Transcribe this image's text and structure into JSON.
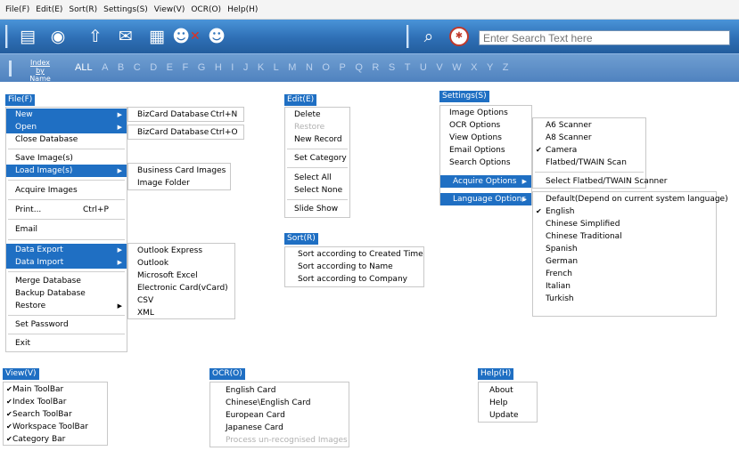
{
  "menubar": [
    "File(F)",
    "Edit(E)",
    "Sort(R)",
    "Settings(S)",
    "View(V)",
    "OCR(O)",
    "Help(H)"
  ],
  "toolbar": {
    "icons": [
      "scan-card-icon",
      "camera-icon",
      "import-icon",
      "export-icon",
      "card-view-icon",
      "delete-contact-icon",
      "group-icon",
      "search-icon",
      "ocr-icon"
    ],
    "search_placeholder": "Enter Search Text here"
  },
  "indexbar": {
    "label_line1": "Index by",
    "label_line2": "Name",
    "letters": [
      "ALL",
      "A",
      "B",
      "C",
      "D",
      "E",
      "F",
      "G",
      "H",
      "I",
      "J",
      "K",
      "L",
      "M",
      "N",
      "O",
      "P",
      "Q",
      "R",
      "S",
      "T",
      "U",
      "V",
      "W",
      "X",
      "Y",
      "Z"
    ]
  },
  "file_menu": {
    "title": "File(F)",
    "items": {
      "new": "New",
      "open": "Open",
      "close": "Close Database",
      "save": "Save Image(s)",
      "load": "Load Image(s)",
      "acquire": "Acquire Images",
      "print": "Print...",
      "print_sc": "Ctrl+P",
      "email": "Email",
      "export": "Data Export",
      "import": "Data Import",
      "merge": "Merge Database",
      "backup": "Backup Database",
      "restore": "Restore",
      "password": "Set Password",
      "exit": "Exit"
    },
    "new_sub": {
      "label": "BizCard Database",
      "shortcut": "Ctrl+N"
    },
    "open_sub": {
      "label": "BizCard Database",
      "shortcut": "Ctrl+O"
    },
    "load_sub": [
      "Business Card Images",
      "Image Folder"
    ],
    "export_sub": [
      "Outlook Express",
      "Outlook",
      "Microsoft Excel",
      "Electronic Card(vCard)",
      "CSV",
      "XML"
    ]
  },
  "edit_menu": {
    "title": "Edit(E)",
    "items": [
      "Delete",
      "Restore",
      "New Record",
      "Set Category",
      "Select All",
      "Select None",
      "Slide Show"
    ]
  },
  "sort_menu": {
    "title": "Sort(R)",
    "items": [
      "Sort according to Created Time",
      "Sort according to Name",
      "Sort according to Company"
    ]
  },
  "settings_menu": {
    "title": "Settings(S)",
    "items": [
      "Image Options",
      "OCR Options",
      "View Options",
      "Email Options",
      "Search Options",
      "Acquire Options",
      "Language Options"
    ],
    "acquire_sub": [
      "A6 Scanner",
      "A8 Scanner",
      "Camera",
      "Flatbed/TWAIN Scan",
      "Select Flatbed/TWAIN Scanner"
    ],
    "language_sub": [
      "Default(Depend on current system language)",
      "English",
      "Chinese Simplified",
      "Chinese Traditional",
      "Spanish",
      "German",
      "French",
      "Italian",
      "Turkish"
    ]
  },
  "view_menu": {
    "title": "View(V)",
    "items": [
      "Main ToolBar",
      "Index ToolBar",
      "Search ToolBar",
      "Workspace ToolBar",
      "Category Bar"
    ]
  },
  "ocr_menu": {
    "title": "OCR(O)",
    "items": [
      "English Card",
      "Chinese\\English Card",
      "European Card",
      "Japanese Card",
      "Process un-recognised Images"
    ]
  },
  "help_menu": {
    "title": "Help(H)",
    "items": [
      "About",
      "Help",
      "Update"
    ]
  }
}
